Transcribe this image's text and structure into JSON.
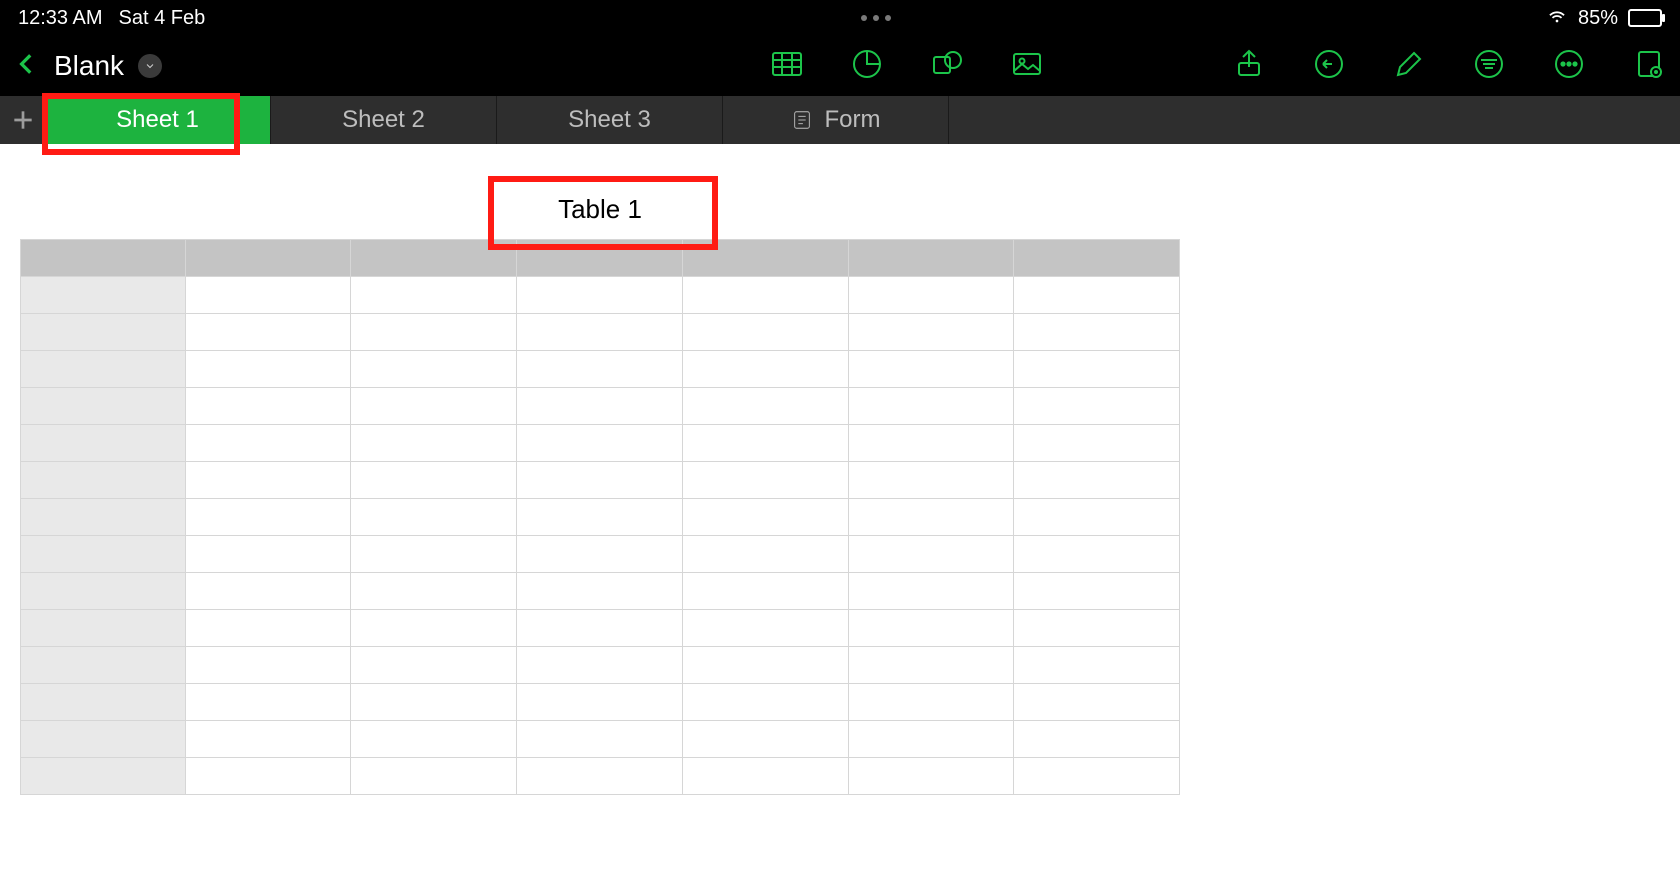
{
  "status": {
    "time": "12:33 AM",
    "date": "Sat 4 Feb",
    "battery_pct": "85%"
  },
  "document": {
    "title": "Blank"
  },
  "tabs": [
    {
      "label": "Sheet 1",
      "active": true
    },
    {
      "label": "Sheet 2",
      "active": false
    },
    {
      "label": "Sheet 3",
      "active": false
    },
    {
      "label": "Form",
      "active": false,
      "is_form": true
    }
  ],
  "table": {
    "title": "Table 1",
    "columns": 7,
    "rows": 14
  },
  "colors": {
    "accent": "#1cc44a",
    "highlight": "#ff1b14"
  }
}
